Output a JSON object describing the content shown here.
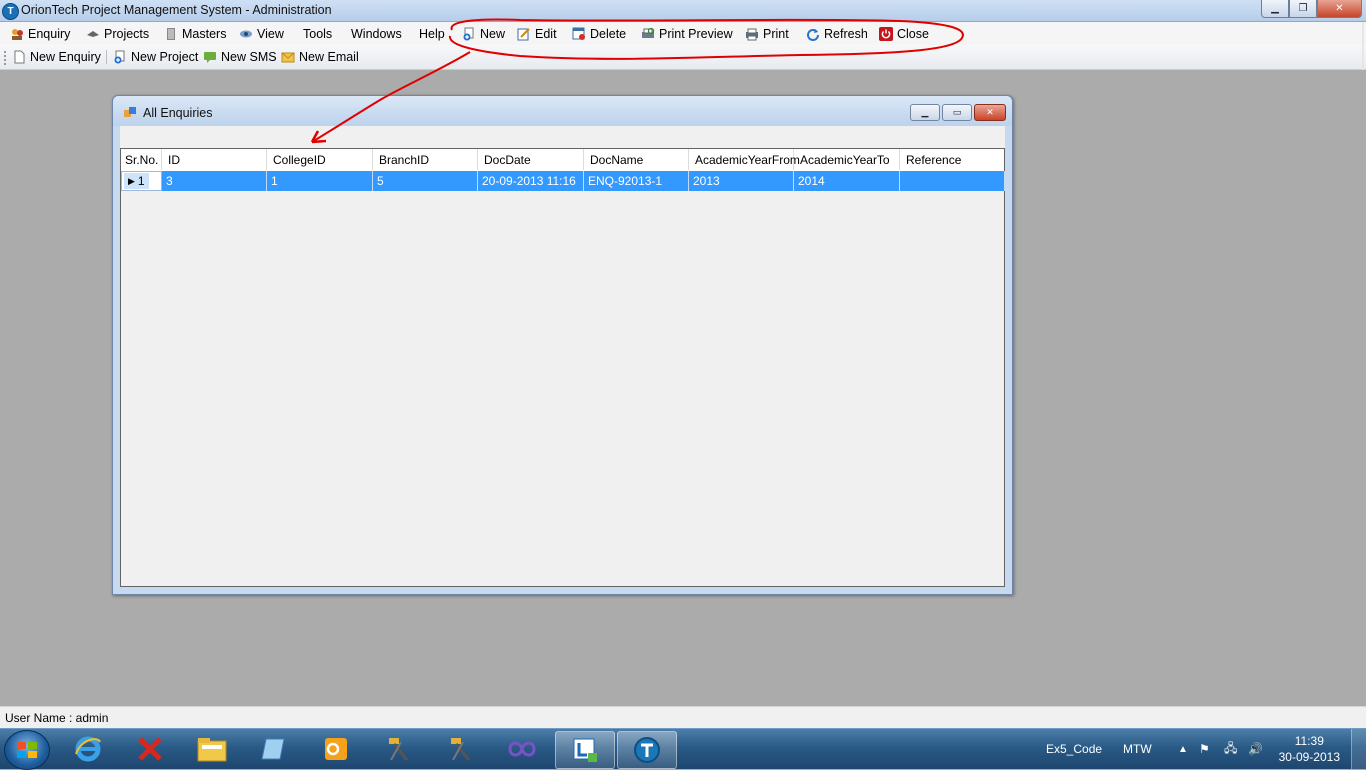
{
  "window": {
    "title": "OrionTech Project Management System - Administration",
    "app_icon_letter": "T"
  },
  "menu": {
    "items": [
      "Enquiry",
      "Projects",
      "Masters",
      "View",
      "Tools",
      "Windows",
      "Help"
    ],
    "actions": [
      "New",
      "Edit",
      "Delete",
      "Print Preview",
      "Print",
      "Refresh",
      "Close"
    ]
  },
  "quickbar": {
    "items": [
      "New Enquiry",
      "New Project",
      "New SMS",
      "New Email"
    ]
  },
  "child_window": {
    "title": "All Enquiries"
  },
  "grid": {
    "columns": [
      "Sr.No.",
      "ID",
      "CollegeID",
      "BranchID",
      "DocDate",
      "DocName",
      "AcademicYearFrom",
      "AcademicYearTo",
      "Reference"
    ],
    "rows": [
      {
        "srno": "1",
        "id": "3",
        "college_id": "1",
        "branch_id": "5",
        "doc_date": "20-09-2013 11:16",
        "doc_name": "ENQ-92013-1",
        "year_from": "2013",
        "year_to": "2014",
        "reference": ""
      }
    ]
  },
  "status": {
    "user": "User Name : admin"
  },
  "taskbar": {
    "tray_items": [
      "Ex5_Code",
      "MTW"
    ],
    "time": "11:39",
    "date": "30-09-2013"
  },
  "colors": {
    "annotation": "#e00000",
    "selection": "#3399ff"
  }
}
